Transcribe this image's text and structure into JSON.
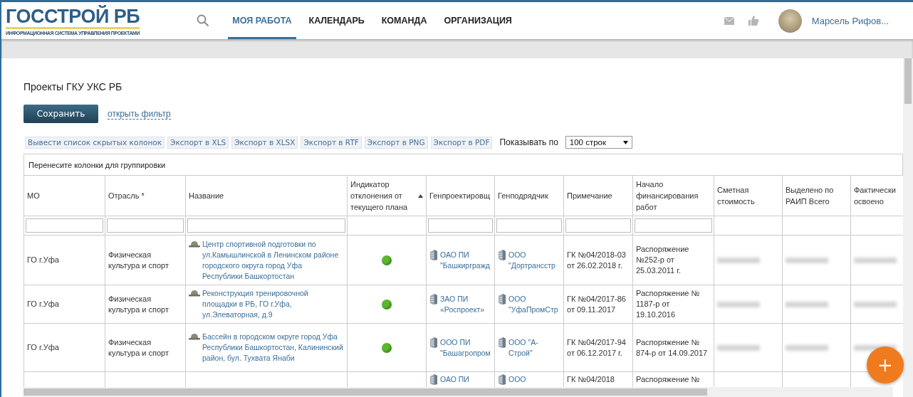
{
  "header": {
    "logo": {
      "title": "ГОССТРОЙ РБ",
      "subtitle": "ИНФОРМАЦИОННАЯ СИСТЕМА УПРАВЛЕНИЯ ПРОЕКТАМИ"
    },
    "nav": [
      {
        "label": "МОЯ РАБОТА",
        "selected": true
      },
      {
        "label": "КАЛЕНДАРЬ",
        "selected": false
      },
      {
        "label": "КОМАНДА",
        "selected": false
      },
      {
        "label": "ОРГАНИЗАЦИЯ",
        "selected": false
      }
    ],
    "user": {
      "name": "Марсель Рифов..."
    }
  },
  "page": {
    "title": "Проекты ГКУ УКС РБ",
    "save_button": "Сохранить",
    "filter_link": "открыть фильтр",
    "toolbar": [
      "Вывести список скрытых колонок",
      "Экспорт в XLS",
      "Экспорт в XLSX",
      "Экспорт в RTF",
      "Экспорт в PNG",
      "Экспорт в PDF"
    ],
    "page_size_label": "Показывать по",
    "page_size": "100 строк"
  },
  "table": {
    "group_hint": "Перенесите колонки для группировки",
    "columns": [
      {
        "label": "МО",
        "filter": true,
        "sorted": false
      },
      {
        "label": "Отрасль *",
        "filter": true,
        "sorted": false
      },
      {
        "label": "Название",
        "filter": true,
        "sorted": false
      },
      {
        "label": "Индикатор отклонения от текущего плана",
        "filter": false,
        "sorted": true
      },
      {
        "label": "Генпроектировщ",
        "filter": true,
        "sorted": false
      },
      {
        "label": "Генподрядчик",
        "filter": true,
        "sorted": false
      },
      {
        "label": "Примечание",
        "filter": true,
        "sorted": false
      },
      {
        "label": "Начало финансирования работ",
        "filter": true,
        "sorted": false
      },
      {
        "label": "Сметная стоимость",
        "filter": false,
        "sorted": false
      },
      {
        "label": "Выделено по РАИП Всего",
        "filter": false,
        "sorted": false
      },
      {
        "label": "Фактически освоено",
        "filter": false,
        "sorted": false
      }
    ],
    "rows": [
      {
        "mo": "ГО г.Уфа",
        "branch": "Физическая культура и спорт",
        "name": "Центр спортивной подготовки по ул.Камышлинской в Ленинском районе городского округа город Уфа Республики Башкортостан",
        "color": "#5cb82e",
        "designer": "ОАО ПИ \"Башкиргражд",
        "contractor": "ООО \"Дортрансстр",
        "note": "ГК №04/2018-03 от 26.02.2018 г.",
        "funding_start": "Распоряжение №252-р от 25.03.2011 г.",
        "amounts_blurred": true
      },
      {
        "mo": "ГО г.Уфа",
        "branch": "Физическая культура и спорт",
        "name": "Реконструкция тренировочной площадки в РБ, ГО г.Уфа, ул.Элеваторная, д.9",
        "color": "#5cb82e",
        "designer": "ЗАО ПИ «Роспроект»",
        "contractor": "ООО \"УфаПромСтр",
        "note": "ГК №04/2017-86 от 09.11.2017",
        "funding_start": "Распоряжение № 1187-р от 19.10.2016",
        "amounts_blurred": true
      },
      {
        "mo": "ГО г.Уфа",
        "branch": "Физическая культура и спорт",
        "name": "Бассейн в городском округе город Уфа Республики Башкортостан, Калининский район, бул. Тухвата Янаби",
        "color": "#5cb82e",
        "designer": "ООО ПИ \"Башагропром",
        "contractor": "ООО \"А-Строй\"",
        "note": "ГК №04/2017-94 от 06.12.2017 г.",
        "funding_start": "Распоряжение № 874-р от 14.09.2017",
        "amounts_blurred": true
      },
      {
        "designer": "ОАО ПИ",
        "contractor": "ООО",
        "note": "ГК №04/2018",
        "funding_start": "Распоряжение №",
        "amounts_blurred": false
      }
    ]
  },
  "fab": {
    "label": "+"
  }
}
